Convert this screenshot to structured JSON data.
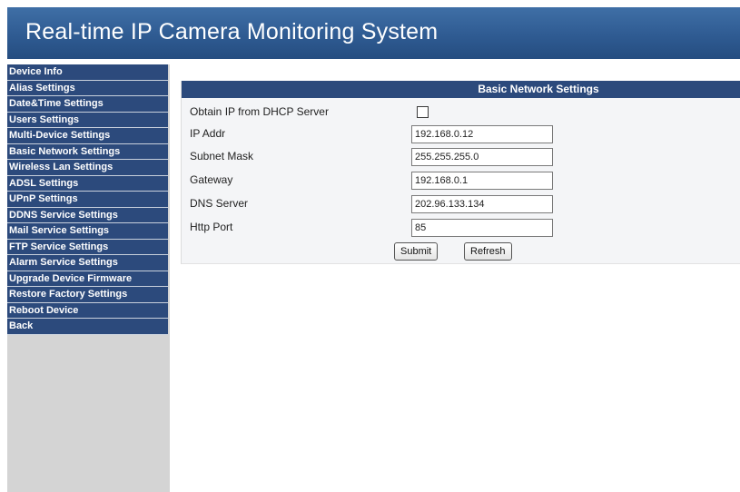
{
  "header": {
    "title": "Real-time IP Camera Monitoring System"
  },
  "sidebar": {
    "items": [
      {
        "label": "Device Info"
      },
      {
        "label": "Alias Settings"
      },
      {
        "label": "Date&Time Settings"
      },
      {
        "label": "Users Settings"
      },
      {
        "label": "Multi-Device Settings"
      },
      {
        "label": "Basic Network Settings"
      },
      {
        "label": "Wireless Lan Settings"
      },
      {
        "label": "ADSL Settings"
      },
      {
        "label": "UPnP Settings"
      },
      {
        "label": "DDNS Service Settings"
      },
      {
        "label": "Mail Service Settings"
      },
      {
        "label": "FTP Service Settings"
      },
      {
        "label": "Alarm Service Settings"
      },
      {
        "label": "Upgrade Device Firmware"
      },
      {
        "label": "Restore Factory Settings"
      },
      {
        "label": "Reboot Device"
      },
      {
        "label": "Back"
      }
    ]
  },
  "form": {
    "title": "Basic Network Settings",
    "dhcp": {
      "label": "Obtain IP from DHCP Server",
      "checked": false
    },
    "ip": {
      "label": "IP Addr",
      "value": "192.168.0.12"
    },
    "mask": {
      "label": "Subnet Mask",
      "value": "255.255.255.0"
    },
    "gateway": {
      "label": "Gateway",
      "value": "192.168.0.1"
    },
    "dns": {
      "label": "DNS Server",
      "value": "202.96.133.134"
    },
    "port": {
      "label": "Http Port",
      "value": "85"
    },
    "submit_label": "Submit",
    "refresh_label": "Refresh"
  },
  "colors": {
    "header": "#2f5b92",
    "nav": "#2c4a7c",
    "sidebar_bg": "#d4d4d4"
  }
}
